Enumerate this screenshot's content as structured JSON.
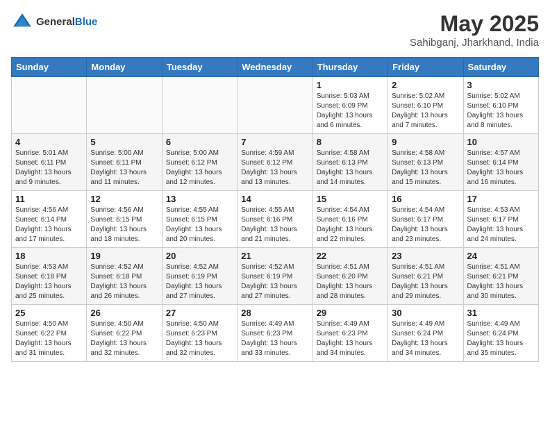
{
  "header": {
    "logo_line1": "General",
    "logo_line2": "Blue",
    "month_year": "May 2025",
    "location": "Sahibganj, Jharkhand, India"
  },
  "weekdays": [
    "Sunday",
    "Monday",
    "Tuesday",
    "Wednesday",
    "Thursday",
    "Friday",
    "Saturday"
  ],
  "weeks": [
    [
      {
        "day": "",
        "info": ""
      },
      {
        "day": "",
        "info": ""
      },
      {
        "day": "",
        "info": ""
      },
      {
        "day": "",
        "info": ""
      },
      {
        "day": "1",
        "info": "Sunrise: 5:03 AM\nSunset: 6:09 PM\nDaylight: 13 hours\nand 6 minutes."
      },
      {
        "day": "2",
        "info": "Sunrise: 5:02 AM\nSunset: 6:10 PM\nDaylight: 13 hours\nand 7 minutes."
      },
      {
        "day": "3",
        "info": "Sunrise: 5:02 AM\nSunset: 6:10 PM\nDaylight: 13 hours\nand 8 minutes."
      }
    ],
    [
      {
        "day": "4",
        "info": "Sunrise: 5:01 AM\nSunset: 6:11 PM\nDaylight: 13 hours\nand 9 minutes."
      },
      {
        "day": "5",
        "info": "Sunrise: 5:00 AM\nSunset: 6:11 PM\nDaylight: 13 hours\nand 11 minutes."
      },
      {
        "day": "6",
        "info": "Sunrise: 5:00 AM\nSunset: 6:12 PM\nDaylight: 13 hours\nand 12 minutes."
      },
      {
        "day": "7",
        "info": "Sunrise: 4:59 AM\nSunset: 6:12 PM\nDaylight: 13 hours\nand 13 minutes."
      },
      {
        "day": "8",
        "info": "Sunrise: 4:58 AM\nSunset: 6:13 PM\nDaylight: 13 hours\nand 14 minutes."
      },
      {
        "day": "9",
        "info": "Sunrise: 4:58 AM\nSunset: 6:13 PM\nDaylight: 13 hours\nand 15 minutes."
      },
      {
        "day": "10",
        "info": "Sunrise: 4:57 AM\nSunset: 6:14 PM\nDaylight: 13 hours\nand 16 minutes."
      }
    ],
    [
      {
        "day": "11",
        "info": "Sunrise: 4:56 AM\nSunset: 6:14 PM\nDaylight: 13 hours\nand 17 minutes."
      },
      {
        "day": "12",
        "info": "Sunrise: 4:56 AM\nSunset: 6:15 PM\nDaylight: 13 hours\nand 18 minutes."
      },
      {
        "day": "13",
        "info": "Sunrise: 4:55 AM\nSunset: 6:15 PM\nDaylight: 13 hours\nand 20 minutes."
      },
      {
        "day": "14",
        "info": "Sunrise: 4:55 AM\nSunset: 6:16 PM\nDaylight: 13 hours\nand 21 minutes."
      },
      {
        "day": "15",
        "info": "Sunrise: 4:54 AM\nSunset: 6:16 PM\nDaylight: 13 hours\nand 22 minutes."
      },
      {
        "day": "16",
        "info": "Sunrise: 4:54 AM\nSunset: 6:17 PM\nDaylight: 13 hours\nand 23 minutes."
      },
      {
        "day": "17",
        "info": "Sunrise: 4:53 AM\nSunset: 6:17 PM\nDaylight: 13 hours\nand 24 minutes."
      }
    ],
    [
      {
        "day": "18",
        "info": "Sunrise: 4:53 AM\nSunset: 6:18 PM\nDaylight: 13 hours\nand 25 minutes."
      },
      {
        "day": "19",
        "info": "Sunrise: 4:52 AM\nSunset: 6:18 PM\nDaylight: 13 hours\nand 26 minutes."
      },
      {
        "day": "20",
        "info": "Sunrise: 4:52 AM\nSunset: 6:19 PM\nDaylight: 13 hours\nand 27 minutes."
      },
      {
        "day": "21",
        "info": "Sunrise: 4:52 AM\nSunset: 6:19 PM\nDaylight: 13 hours\nand 27 minutes."
      },
      {
        "day": "22",
        "info": "Sunrise: 4:51 AM\nSunset: 6:20 PM\nDaylight: 13 hours\nand 28 minutes."
      },
      {
        "day": "23",
        "info": "Sunrise: 4:51 AM\nSunset: 6:21 PM\nDaylight: 13 hours\nand 29 minutes."
      },
      {
        "day": "24",
        "info": "Sunrise: 4:51 AM\nSunset: 6:21 PM\nDaylight: 13 hours\nand 30 minutes."
      }
    ],
    [
      {
        "day": "25",
        "info": "Sunrise: 4:50 AM\nSunset: 6:22 PM\nDaylight: 13 hours\nand 31 minutes."
      },
      {
        "day": "26",
        "info": "Sunrise: 4:50 AM\nSunset: 6:22 PM\nDaylight: 13 hours\nand 32 minutes."
      },
      {
        "day": "27",
        "info": "Sunrise: 4:50 AM\nSunset: 6:23 PM\nDaylight: 13 hours\nand 32 minutes."
      },
      {
        "day": "28",
        "info": "Sunrise: 4:49 AM\nSunset: 6:23 PM\nDaylight: 13 hours\nand 33 minutes."
      },
      {
        "day": "29",
        "info": "Sunrise: 4:49 AM\nSunset: 6:23 PM\nDaylight: 13 hours\nand 34 minutes."
      },
      {
        "day": "30",
        "info": "Sunrise: 4:49 AM\nSunset: 6:24 PM\nDaylight: 13 hours\nand 34 minutes."
      },
      {
        "day": "31",
        "info": "Sunrise: 4:49 AM\nSunset: 6:24 PM\nDaylight: 13 hours\nand 35 minutes."
      }
    ]
  ]
}
